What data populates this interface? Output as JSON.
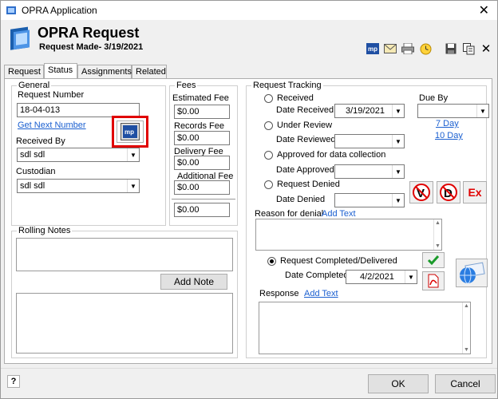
{
  "window": {
    "title": "OPRA Application"
  },
  "header": {
    "title": "OPRA Request",
    "subtitle": "Request Made- 3/19/2021"
  },
  "toolbar": {
    "icons": [
      "mp-icon",
      "email-icon",
      "print-icon",
      "clock-icon",
      "save-icon",
      "copy-icon",
      "close-icon"
    ]
  },
  "tabs": [
    "Request",
    "Status",
    "Assignments",
    "Related"
  ],
  "general": {
    "label": "General",
    "request_number_label": "Request Number",
    "request_number": "18-04-013",
    "get_next_number": "Get Next Number",
    "received_by_label": "Received By",
    "received_by": "sdl sdl",
    "custodian_label": "Custodian",
    "custodian": "sdl sdl"
  },
  "fees": {
    "label": "Fees",
    "estimated_label": "Estimated Fee",
    "estimated": "$0.00",
    "records_label": "Records Fee",
    "records": "$0.00",
    "delivery_label": "Delivery Fee",
    "delivery": "$0.00",
    "additional_label": "Additional Fee",
    "additional": "$0.00",
    "total": "$0.00"
  },
  "tracking": {
    "label": "Request Tracking",
    "received": "Received",
    "date_received_label": "Date Received",
    "date_received": "3/19/2021",
    "due_by_label": "Due By",
    "due_7": "7 Day",
    "due_10": "10 Day",
    "under_review": "Under Review",
    "date_reviewed_label": "Date Reviewed",
    "approved": "Approved for data collection",
    "date_approved_label": "Date Approved",
    "denied": "Request Denied",
    "date_denied_label": "Date Denied",
    "ex_label": "Ex",
    "reason_label": "Reason for denial",
    "add_text": "Add Text",
    "completed": "Request Completed/Delivered",
    "date_completed_label": "Date Completed",
    "date_completed": "4/2/2021",
    "response_label": "Response",
    "response_add_text": "Add Text"
  },
  "rolling": {
    "label": "Rolling Notes",
    "add_note": "Add Note"
  },
  "footer": {
    "ok": "OK",
    "cancel": "Cancel",
    "ok_key": "O",
    "cancel_key": "C"
  }
}
